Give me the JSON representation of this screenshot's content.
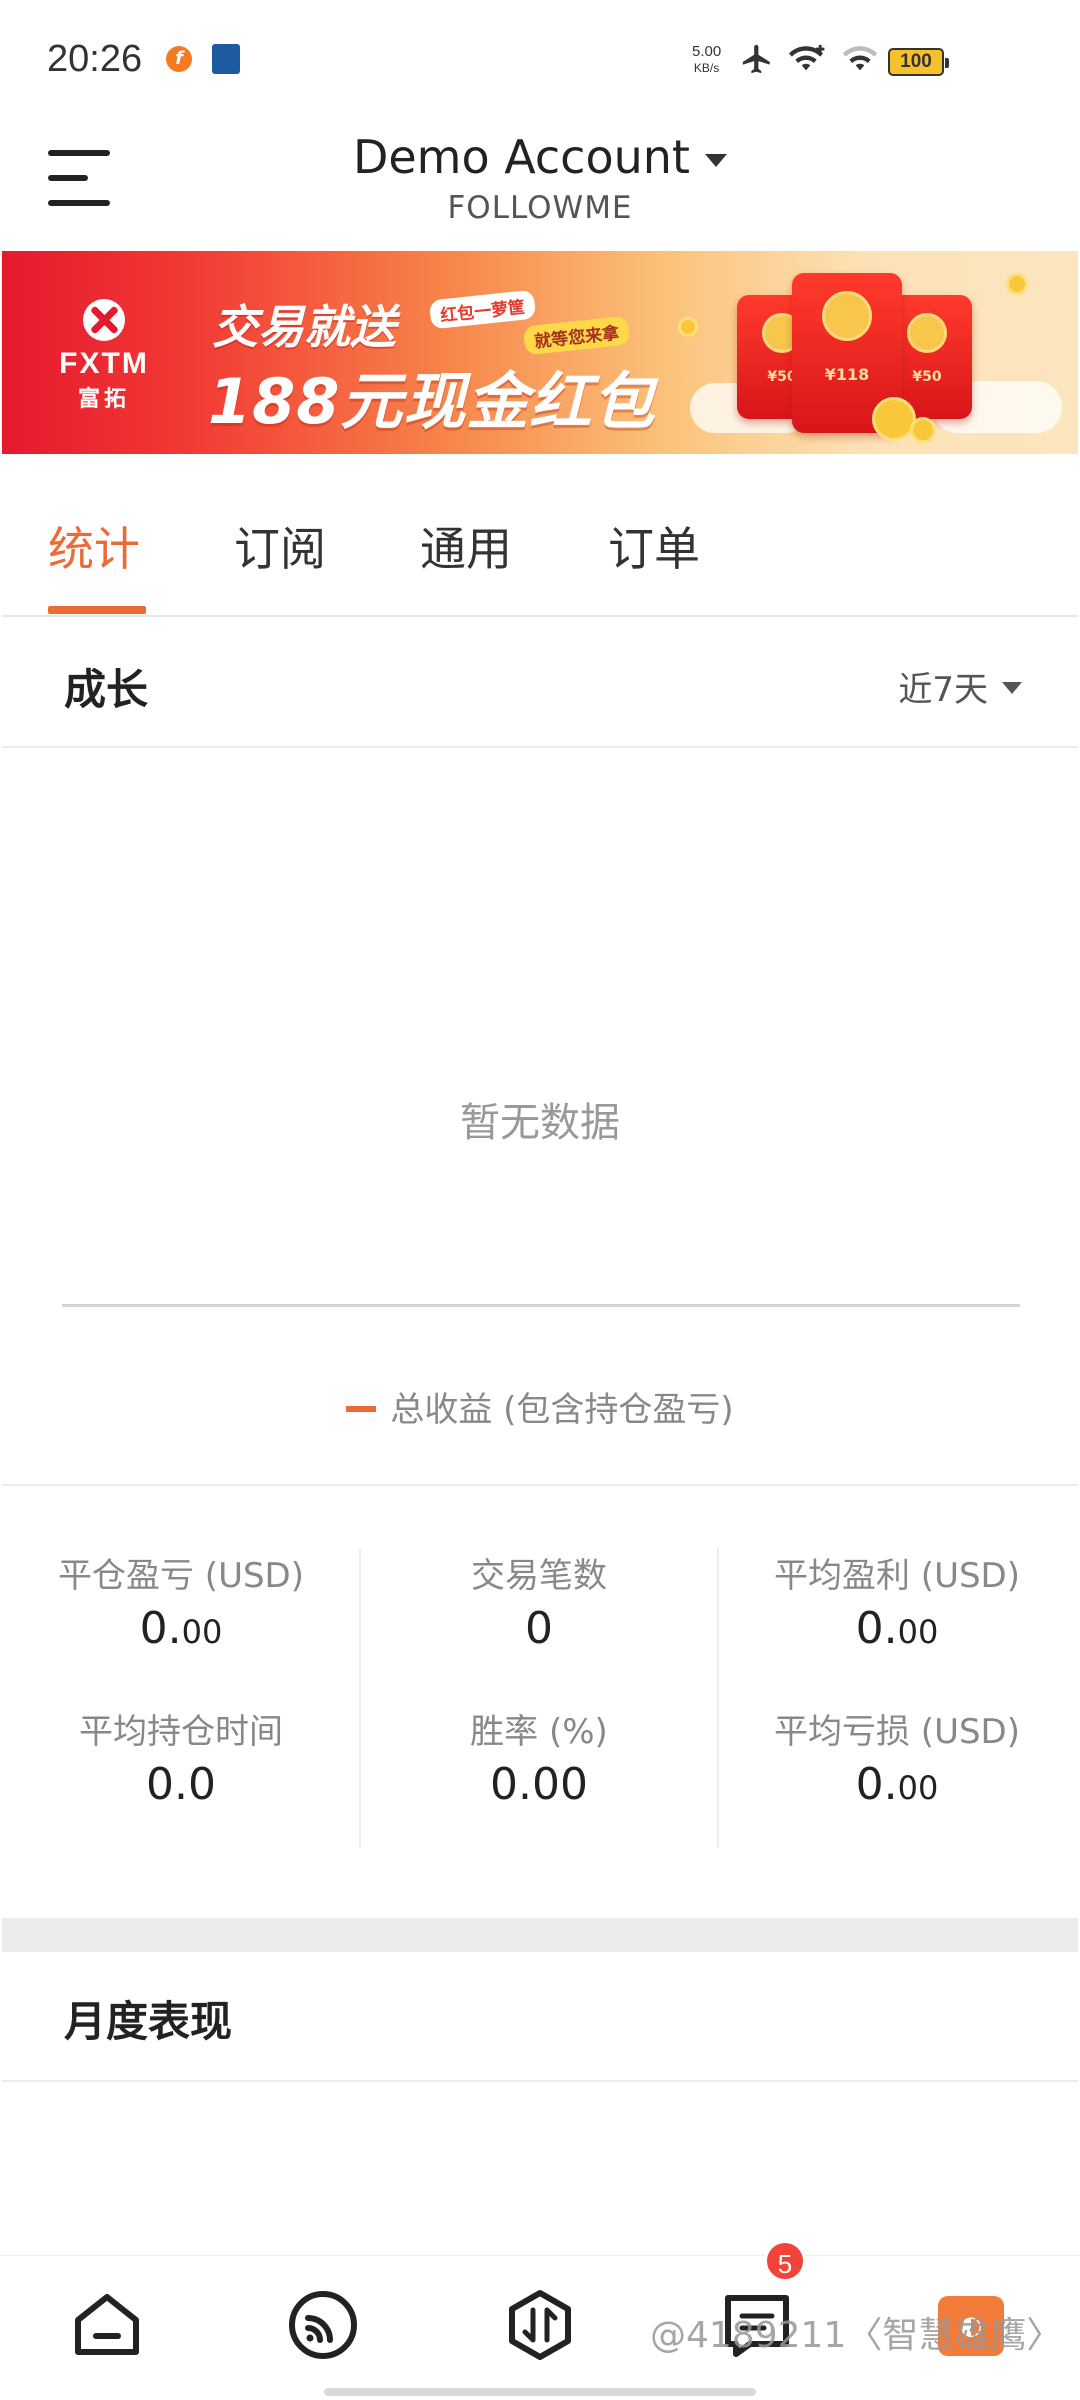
{
  "status_bar": {
    "time": "20:26",
    "net_speed_value": "5.00",
    "net_speed_unit": "KB/s",
    "battery": "100",
    "icons": [
      "airplane-icon",
      "wifi-icon",
      "wifi-icon",
      "battery-icon"
    ]
  },
  "header": {
    "title": "Demo Account",
    "subtitle": "FOLLOWME"
  },
  "banner": {
    "brand": "FXTM",
    "brand_cn": "富拓",
    "line1": "交易就送",
    "tag1": "红包一萝筐",
    "tag2": "就等您来拿",
    "line2": "188元现金红包",
    "envelope_labels": [
      "¥50",
      "¥118",
      "¥50"
    ]
  },
  "tabs": [
    {
      "label": "统计",
      "active": true
    },
    {
      "label": "订阅",
      "active": false
    },
    {
      "label": "通用",
      "active": false
    },
    {
      "label": "订单",
      "active": false
    }
  ],
  "growth": {
    "title": "成长",
    "period": "近7天",
    "empty_text": "暂无数据",
    "legend": "总收益 (包含持仓盈亏)"
  },
  "stats": [
    {
      "label": "平仓盈亏 (USD)",
      "value_main": "0.",
      "value_small": "00"
    },
    {
      "label": "交易笔数",
      "value_main": "0",
      "value_small": ""
    },
    {
      "label": "平均盈利 (USD)",
      "value_main": "0.",
      "value_small": "00"
    },
    {
      "label": "平均持仓时间",
      "value_main": "0.0",
      "value_small": ""
    },
    {
      "label": "胜率 (%)",
      "value_main": "0.00",
      "value_small": ""
    },
    {
      "label": "平均亏损 (USD)",
      "value_main": "0.",
      "value_small": "00"
    }
  ],
  "monthly": {
    "title": "月度表现"
  },
  "bottom_nav": {
    "items": [
      "home-icon",
      "feed-icon",
      "trade-icon",
      "message-icon",
      "profile-icon"
    ],
    "message_badge": "5",
    "watermark": "⁠@4189211〈智慧雄鹰〉"
  },
  "colors": {
    "accent": "#ee6a35",
    "badge": "#f2433a",
    "banner_red": "#e5192e"
  }
}
